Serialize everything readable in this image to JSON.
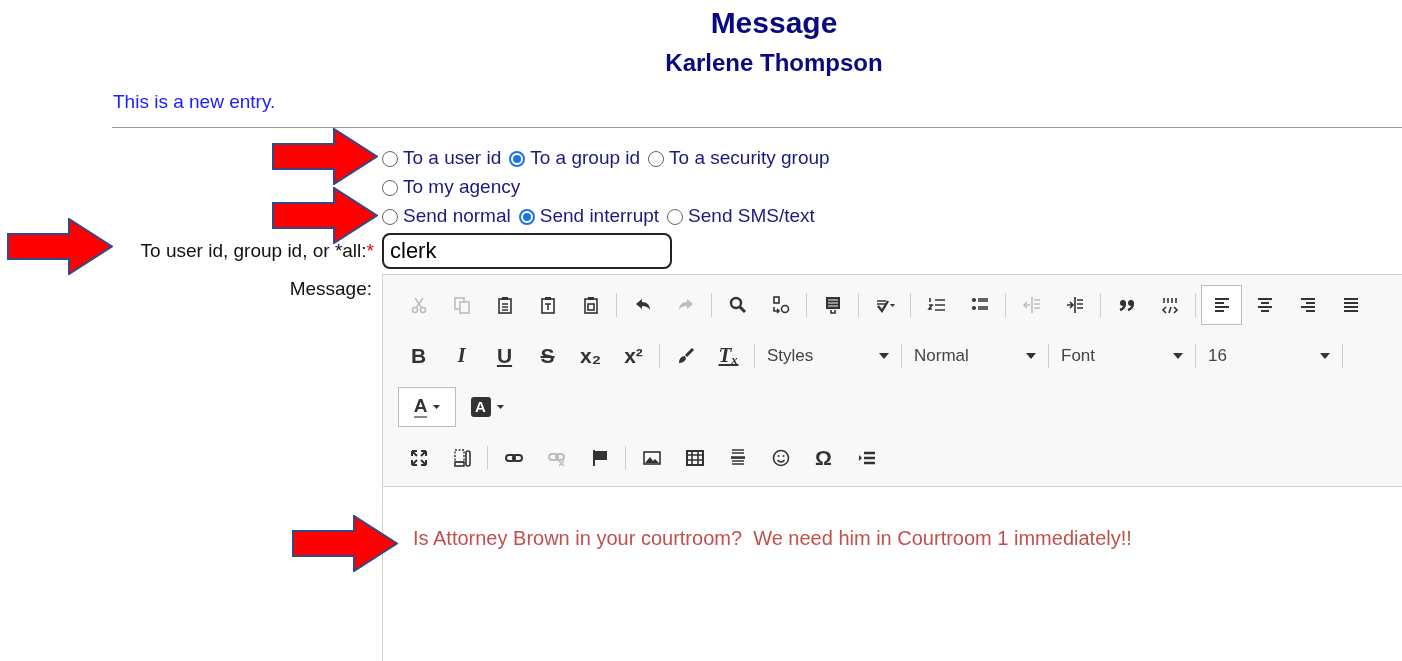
{
  "title": "Message",
  "subtitle": "Karlene Thompson",
  "notice": "This is a new entry.",
  "recipient_options": [
    {
      "label": "To a user id",
      "selected": false
    },
    {
      "label": "To a group id",
      "selected": true
    },
    {
      "label": "To a security group",
      "selected": false
    },
    {
      "label": "To my agency",
      "selected": false
    }
  ],
  "delivery_options": [
    {
      "label": "Send normal",
      "selected": false
    },
    {
      "label": "Send interrupt",
      "selected": true
    },
    {
      "label": "Send SMS/text",
      "selected": false
    }
  ],
  "recipient_field": {
    "label": "To user id, group id, or *all:",
    "required_mark": "*",
    "value": "clerk"
  },
  "message_label": "Message:",
  "toolbar": {
    "rows": [
      {
        "items": [
          {
            "kind": "icon",
            "disabled": true,
            "pressed": false
          },
          {
            "kind": "icon",
            "disabled": true,
            "pressed": false
          },
          {
            "kind": "icon",
            "disabled": false,
            "pressed": false
          },
          {
            "kind": "icon",
            "disabled": false,
            "pressed": false
          },
          {
            "kind": "icon",
            "disabled": false,
            "pressed": false
          },
          {
            "kind": "separator"
          },
          {
            "kind": "icon",
            "disabled": false,
            "pressed": false
          },
          {
            "kind": "icon",
            "disabled": true,
            "pressed": false
          },
          {
            "kind": "separator"
          },
          {
            "kind": "icon",
            "disabled": false,
            "pressed": false
          },
          {
            "kind": "icon",
            "disabled": false,
            "pressed": false
          },
          {
            "kind": "separator"
          },
          {
            "kind": "icon",
            "disabled": false,
            "pressed": false
          },
          {
            "kind": "separator"
          },
          {
            "kind": "icon",
            "disabled": false,
            "pressed": false
          },
          {
            "kind": "separator"
          },
          {
            "kind": "icon",
            "disabled": false,
            "pressed": false
          },
          {
            "kind": "icon",
            "disabled": false,
            "pressed": false
          },
          {
            "kind": "separator"
          },
          {
            "kind": "icon",
            "disabled": true,
            "pressed": false
          },
          {
            "kind": "icon",
            "disabled": false,
            "pressed": false
          },
          {
            "kind": "separator"
          },
          {
            "kind": "icon",
            "disabled": false,
            "pressed": false
          },
          {
            "kind": "icon",
            "disabled": false,
            "pressed": false
          },
          {
            "kind": "separator"
          },
          {
            "kind": "icon",
            "disabled": false,
            "pressed": true
          },
          {
            "kind": "icon",
            "disabled": false,
            "pressed": false
          },
          {
            "kind": "icon",
            "disabled": false,
            "pressed": false
          },
          {
            "kind": "icon",
            "disabled": false,
            "pressed": false
          }
        ]
      },
      {
        "items": [
          {
            "kind": "bold",
            "glyph": "B",
            "disabled": false,
            "pressed": false
          },
          {
            "kind": "italic",
            "glyph": "I",
            "disabled": false,
            "pressed": false
          },
          {
            "kind": "underline",
            "glyph": "U",
            "disabled": false,
            "pressed": false
          },
          {
            "kind": "strike",
            "glyph": "S",
            "disabled": false,
            "pressed": false
          },
          {
            "kind": "bold",
            "glyph": "x₂",
            "disabled": false,
            "pressed": false
          },
          {
            "kind": "bold",
            "glyph": "x²",
            "disabled": false,
            "pressed": false
          },
          {
            "kind": "separator"
          },
          {
            "kind": "icon",
            "disabled": false,
            "pressed": false
          },
          {
            "kind": "clearformat",
            "glyph": "Tₓ",
            "disabled": false,
            "pressed": false
          },
          {
            "kind": "separator"
          },
          {
            "kind": "combo",
            "label": "Styles"
          },
          {
            "kind": "separator"
          },
          {
            "kind": "combo",
            "label": "Normal"
          },
          {
            "kind": "separator"
          },
          {
            "kind": "combo",
            "label": "Font"
          },
          {
            "kind": "separator"
          },
          {
            "kind": "combo",
            "label": "16"
          },
          {
            "kind": "separator"
          }
        ]
      },
      {
        "items": [
          {
            "kind": "color",
            "glyph": "A",
            "filled": false,
            "disabled": false,
            "pressed": true
          },
          {
            "kind": "color",
            "glyph": "A",
            "filled": true,
            "disabled": false,
            "pressed": false
          }
        ]
      },
      {
        "items": [
          {
            "kind": "icon",
            "disabled": false,
            "pressed": false
          },
          {
            "kind": "icon",
            "disabled": false,
            "pressed": false
          },
          {
            "kind": "separator"
          },
          {
            "kind": "icon",
            "disabled": false,
            "pressed": false
          },
          {
            "kind": "icon",
            "disabled": true,
            "pressed": false
          },
          {
            "kind": "icon",
            "disabled": false,
            "pressed": false
          },
          {
            "kind": "separator"
          },
          {
            "kind": "icon",
            "disabled": false,
            "pressed": false
          },
          {
            "kind": "icon",
            "disabled": false,
            "pressed": false
          },
          {
            "kind": "icon",
            "disabled": false,
            "pressed": false
          },
          {
            "kind": "icon",
            "disabled": false,
            "pressed": false
          },
          {
            "kind": "bold",
            "glyph": "Ω",
            "disabled": false,
            "pressed": false
          },
          {
            "kind": "icon",
            "disabled": false,
            "pressed": false
          }
        ]
      }
    ]
  },
  "message_body": "Is Attorney Brown in your courtroom?  We need him in Courtroom 1 immediately!!"
}
